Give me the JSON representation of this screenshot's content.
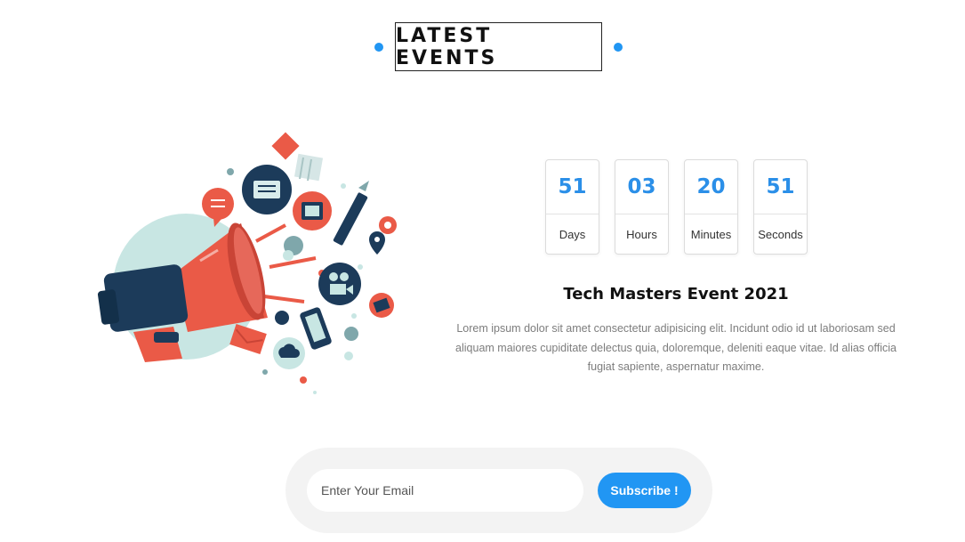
{
  "section": {
    "heading": "LATEST EVENTS"
  },
  "countdown": [
    {
      "value": "51",
      "label": "Days"
    },
    {
      "value": "03",
      "label": "Hours"
    },
    {
      "value": "20",
      "label": "Minutes"
    },
    {
      "value": "51",
      "label": "Seconds"
    }
  ],
  "event": {
    "title": "Tech Masters Event 2021",
    "description": "Lorem ipsum dolor sit amet consectetur adipisicing elit. Incidunt odio id ut laboriosam sed aliquam maiores cupiditate delectus quia, doloremque, deleniti eaque vitae. Id alias officia fugiat sapiente, aspernatur maxime."
  },
  "subscribe": {
    "placeholder": "Enter Your Email",
    "button_label": "Subscribe !"
  },
  "illustration": {
    "icon": "megaphone-icon"
  },
  "colors": {
    "accent": "#2196f3",
    "coral": "#ea5a47",
    "navy": "#1c3b5a",
    "mint": "#c8e6e3"
  }
}
